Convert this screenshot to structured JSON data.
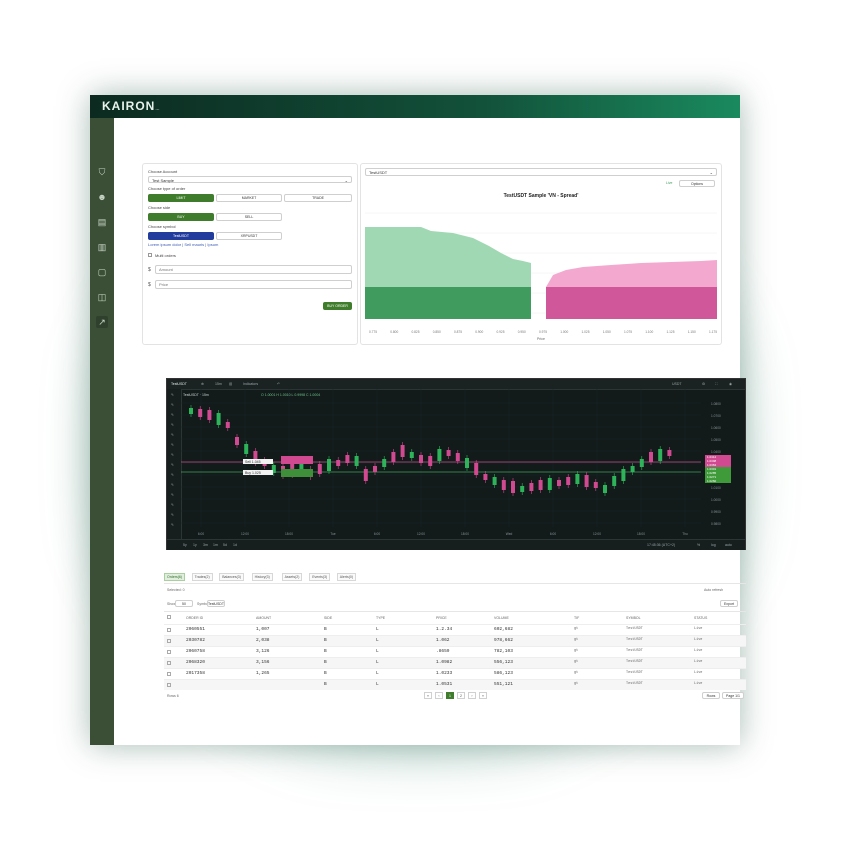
{
  "app": {
    "logo": "KAIRON",
    "logo_suffix": "..."
  },
  "sidebar": {
    "items": [
      {
        "icon": "shield-icon",
        "glyph": "⛉"
      },
      {
        "icon": "users-icon",
        "glyph": "☻"
      },
      {
        "icon": "document-icon",
        "glyph": "▤"
      },
      {
        "icon": "clipboard-icon",
        "glyph": "▥"
      },
      {
        "icon": "file-icon",
        "glyph": "▢"
      },
      {
        "icon": "briefcase-icon",
        "glyph": "◫"
      },
      {
        "icon": "chart-line-icon",
        "glyph": "↗",
        "active": true
      }
    ]
  },
  "order_form": {
    "account_label": "Choose Account",
    "account_value": "Test Sample",
    "order_type_label": "Choose type of order",
    "order_types": [
      "LIMIT",
      "MARKET",
      "TRADE"
    ],
    "side_label": "Choose side",
    "sides": [
      "BUY",
      "SELL"
    ],
    "symbol_label": "Choose symbol",
    "symbols": [
      "TestUSDT",
      "XRPUSDT"
    ],
    "note": "Lorem ipsum dolor | Sell mauris | Ipsum",
    "multi_label": "Multi orders",
    "amount_placeholder": "Amount",
    "price_placeholder": "Price",
    "submit": "BUY ORDER"
  },
  "depth": {
    "symbol_select": "TestUSDT",
    "toggle_label": "Live",
    "options_label": "Options",
    "title": "TestUSDT Sample 'VN - Spread'",
    "xticks": [
      "0.775",
      "0.800",
      "0.825",
      "0.850",
      "0.875",
      "0.900",
      "0.925",
      "0.950",
      "0.975",
      "1.000",
      "1.025",
      "1.050",
      "1.075",
      "1.100",
      "1.125",
      "1.150",
      "1.175"
    ],
    "xlabel": "Price",
    "colors": {
      "bid": "#3f9b5e",
      "bid_light": "#9fd8b2",
      "ask": "#d0589a",
      "ask_light": "#f3a9cf"
    }
  },
  "tv": {
    "symbol": "TestUSDT",
    "interval": "15m",
    "indicators": "Indicators",
    "pair": "TestUSDT · 15m",
    "ohlc": "O 1.0001  H 1.0010  L 0.9998  C 1.0004",
    "currency": "USDT",
    "price_ticks": [
      "1.0800",
      "1.0700",
      "1.0600",
      "1.0500",
      "1.0400",
      "1.0300",
      "1.0200",
      "1.0100",
      "1.0000",
      "0.9900",
      "0.9800"
    ],
    "time_ticks": [
      "6:00",
      "12:00",
      "18:00",
      "Tue",
      "6:00",
      "12:00",
      "18:00",
      "Wed",
      "6:00",
      "12:00",
      "18:00",
      "Thu"
    ],
    "ranges": [
      "5y",
      "1y",
      "3m",
      "1m",
      "5d",
      "1d"
    ],
    "tz": "17:45:36 (UTC+2)",
    "tags": {
      "sell": "Sell 1.045",
      "buy": "Buy 1.025"
    },
    "right_tags": [
      "1.0412",
      "1.0398",
      "1.0384",
      "1.0301",
      "1.0285",
      "1.0271",
      "1.0260"
    ],
    "bottom_right": [
      "%",
      "log",
      "auto"
    ]
  },
  "table": {
    "tabs": [
      "Orders(6)",
      "Trades(2)",
      "Balances(3)",
      "History(3)",
      "Assets(2)",
      "Events(3)",
      "Alerts(0)"
    ],
    "filter_label": "Selected: 0",
    "auto_label": "Auto refresh",
    "show_label": "Show",
    "show_value": "50",
    "symbol_filter_label": "Symbol",
    "symbol_filter_value": "TestUSDT",
    "export": "Export",
    "columns": [
      "ORDER ID",
      "AMOUNT",
      "SIDE",
      "TYPE",
      "PRICE",
      "VOLUME",
      "TIF",
      "SYMBOL",
      "STATUS"
    ],
    "rows": [
      [
        "2060551",
        "1,007",
        "B",
        "L",
        "1.2.34",
        "602,682",
        "gt",
        "TestUSDT",
        "Live"
      ],
      [
        "2030782",
        "2,038",
        "B",
        "L",
        "1.062",
        "978,662",
        "gt",
        "TestUSDT",
        "Live"
      ],
      [
        "2060758",
        "3,126",
        "B",
        "L",
        ".8659",
        "782,103",
        "gt",
        "TestUSDT",
        "Live"
      ],
      [
        "2068320",
        "3,156",
        "B",
        "L",
        "1.0982",
        "556,123",
        "gt",
        "TestUSDT",
        "Live"
      ],
      [
        "2017358",
        "1,265",
        "B",
        "L",
        "1.0233",
        "586,123",
        "gt",
        "TestUSDT",
        "Live"
      ],
      [
        "",
        "",
        "B",
        "L",
        "1.0531",
        "551,121",
        "gt",
        "TestUSDT",
        "Live"
      ]
    ],
    "footer_left": "Rows 6",
    "pages": [
      "«",
      "‹",
      "1",
      "2",
      "›",
      "»"
    ],
    "footer_right": [
      "Rows",
      "Page 1/1"
    ]
  }
}
